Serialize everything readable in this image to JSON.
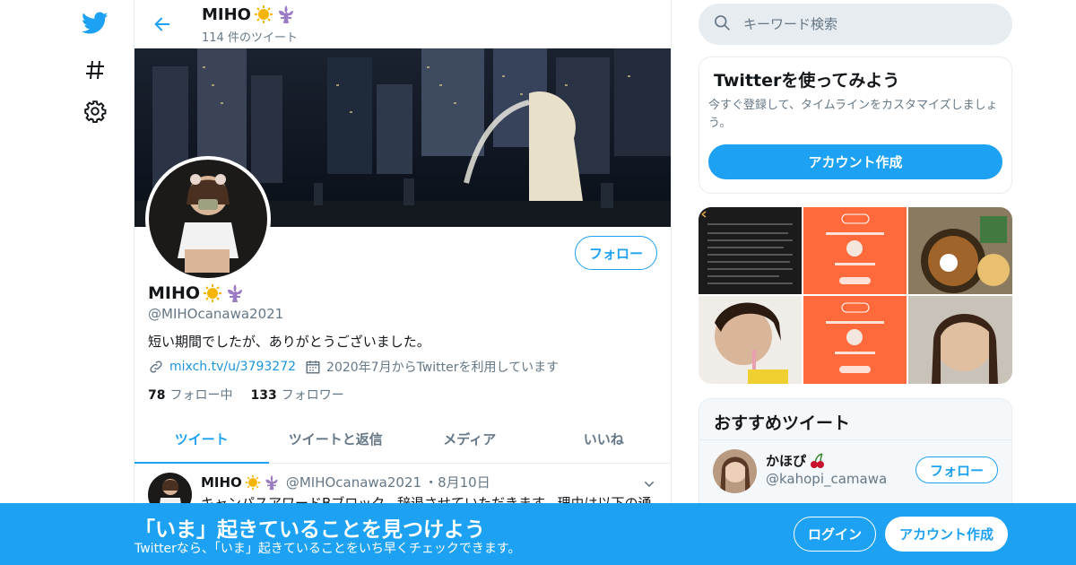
{
  "nav": {
    "icons": [
      "twitter-bird-icon",
      "hashtag-icon",
      "gear-icon"
    ]
  },
  "header": {
    "name": "MIHO",
    "tweet_count": "114 件のツイート"
  },
  "profile": {
    "name": "MIHO",
    "handle": "@MIHOcanawa2021",
    "bio": "短い期間でしたが、ありがとうございました。",
    "link": "mixch.tv/u/3793272",
    "joined": "2020年7月からTwitterを利用しています",
    "following_count": "78",
    "following_label": "フォロー中",
    "followers_count": "133",
    "followers_label": "フォロワー",
    "follow_button": "フォロー"
  },
  "tabs": [
    {
      "label": "ツイート",
      "active": true
    },
    {
      "label": "ツイートと返信",
      "active": false
    },
    {
      "label": "メディア",
      "active": false
    },
    {
      "label": "いいね",
      "active": false
    }
  ],
  "tweet": {
    "name": "MIHO",
    "handle": "@MIHOcanawa2021",
    "date": "・8月10日",
    "text": "キャンパスアワードBブロック、辞退させていただきます。理由は以下の通"
  },
  "search": {
    "placeholder": "キーワード検索"
  },
  "signup_card": {
    "title": "Twitterを使ってみよう",
    "description": "今すぐ登録して、タイムラインをカスタマイズしましょう。",
    "button": "アカウント作成"
  },
  "recommended": {
    "title": "おすすめツイート",
    "user_name": "かほぴ",
    "user_handle": "@kahopi_camawa",
    "follow_button": "フォロー"
  },
  "bottom_bar": {
    "title": "「いま」起きていることを見つけよう",
    "subtitle": "Twitterなら、「いま」起きていることをいち早くチェックできます。",
    "login": "ログイン",
    "signup": "アカウント作成"
  },
  "colors": {
    "accent": "#1da1f2",
    "text": "#14171a",
    "muted": "#657786",
    "border": "#e6ecf0"
  }
}
